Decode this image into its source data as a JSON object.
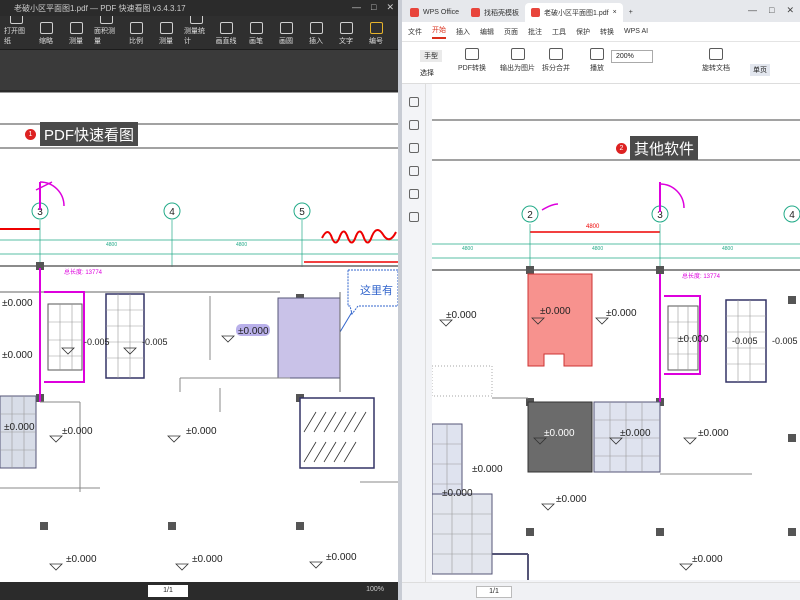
{
  "left_app": {
    "title": "老破小区平面图1.pdf — PDF 快速看图 v3.4.3.17",
    "window_controls": [
      "—",
      "□",
      "✕"
    ],
    "toolbar": [
      {
        "label": "打开图纸",
        "icon": "open-icon"
      },
      {
        "label": "缩略",
        "icon": "thumbnail-icon"
      },
      {
        "label": "测量",
        "icon": "measure-icon"
      },
      {
        "label": "面积测量",
        "icon": "area-icon"
      },
      {
        "label": "比例",
        "icon": "scale-icon"
      },
      {
        "label": "测量",
        "icon": "ruler-icon"
      },
      {
        "label": "测量统计",
        "icon": "stats-icon"
      },
      {
        "label": "画直线",
        "icon": "line-icon"
      },
      {
        "label": "画笔",
        "icon": "pen-icon"
      },
      {
        "label": "画圆",
        "icon": "circle-icon"
      },
      {
        "label": "插入",
        "icon": "insert-icon"
      },
      {
        "label": "文字",
        "icon": "text-icon"
      },
      {
        "label": "编号",
        "icon": "number-icon"
      }
    ],
    "callout": {
      "number": "1",
      "text": "PDF快速看图"
    },
    "status": {
      "page": "1/1",
      "zoom": "100%"
    }
  },
  "right_app": {
    "tabs": [
      {
        "label": "WPS Office",
        "color": "#e8453c"
      },
      {
        "label": "找稻壳模板",
        "color": "#e8453c"
      },
      {
        "label": "老破小区平面图1.pdf",
        "color": "#e8453c",
        "active": true
      }
    ],
    "window_controls": [
      "—",
      "□",
      "✕"
    ],
    "menu": [
      "文件",
      "开始",
      "插入",
      "编辑",
      "页面",
      "批注",
      "工具",
      "保护",
      "转换",
      "WPS AI"
    ],
    "active_menu": "开始",
    "ribbon": {
      "hand": "手型",
      "select": "选择",
      "buttons": [
        "PDF转换",
        "输出为图片",
        "拆分合并",
        "播放",
        "旋转文档",
        "单页"
      ],
      "zoom": "200%",
      "mode": "单页"
    },
    "callout": {
      "number": "2",
      "text": "其他软件"
    },
    "status": {
      "page": "1/1"
    }
  },
  "drawing": {
    "elevation": "±0.000",
    "elevation_small": "-0.005",
    "axis_labels": [
      "2",
      "3",
      "4",
      "5"
    ],
    "dimension": "4800",
    "note": "这里有",
    "length_note": "总长度: 13774"
  }
}
